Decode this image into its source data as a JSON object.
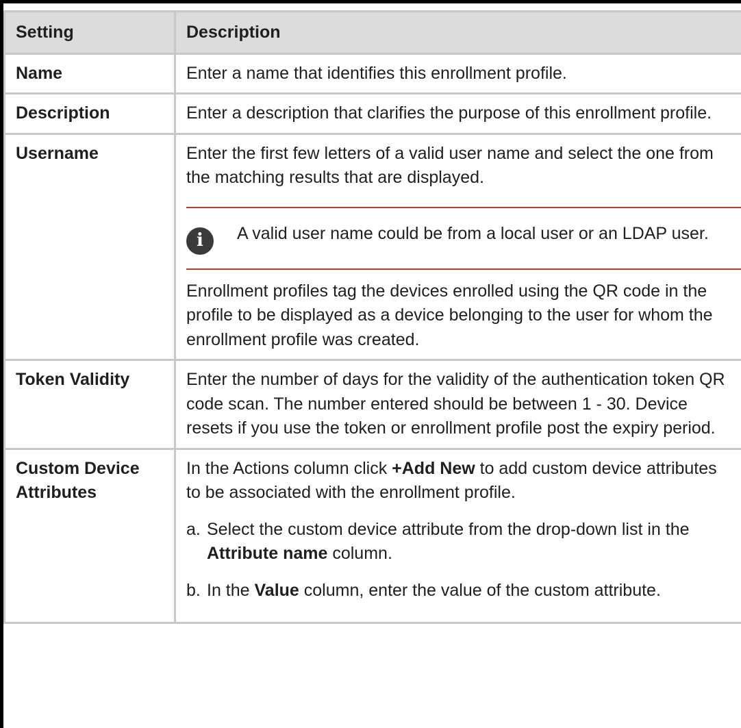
{
  "table": {
    "headers": {
      "setting": "Setting",
      "description": "Description"
    },
    "rows": {
      "name": {
        "setting": "Name",
        "description": "Enter a name that identifies this enrollment profile."
      },
      "description": {
        "setting": "Description",
        "description": "Enter a description that clarifies the purpose of this enrollment profile."
      },
      "username": {
        "setting": "Username",
        "description": "Enter the first few letters of a valid user name and select the one from the matching results that are displayed.",
        "note_icon": "info-icon",
        "note_icon_glyph": "i",
        "note": "A valid user name could be from a local user or an LDAP user.",
        "after_note": "Enrollment profiles tag the devices enrolled using the QR code in the profile to be displayed as a device belonging to the user for whom the enrollment profile was created."
      },
      "token_validity": {
        "setting": "Token Validity",
        "description": "Enter the number of days for the validity of the authentication token QR code scan. The number entered should be between 1 - 30. Device resets if you use the token or enrollment profile post the expiry period."
      },
      "custom_device_attributes": {
        "setting": "Custom Device Attributes",
        "intro_pre": "In the Actions column click ",
        "intro_bold": "+Add New",
        "intro_post": " to add custom device attributes to be associated with the enrollment profile.",
        "steps": {
          "a": {
            "marker": "a.",
            "pre": "Select the custom device attribute from the drop-down list in the ",
            "bold": "Attribute name",
            "post": " column."
          },
          "b": {
            "marker": "b.",
            "pre": "In the ",
            "bold": "Value",
            "post": " column, enter the value of the custom attribute."
          }
        }
      }
    }
  },
  "colors": {
    "header_bg": "#dcdcdc",
    "border": "#c8c8c8",
    "note_rule": "#c0392b",
    "icon_bg": "#3a3a3a"
  }
}
